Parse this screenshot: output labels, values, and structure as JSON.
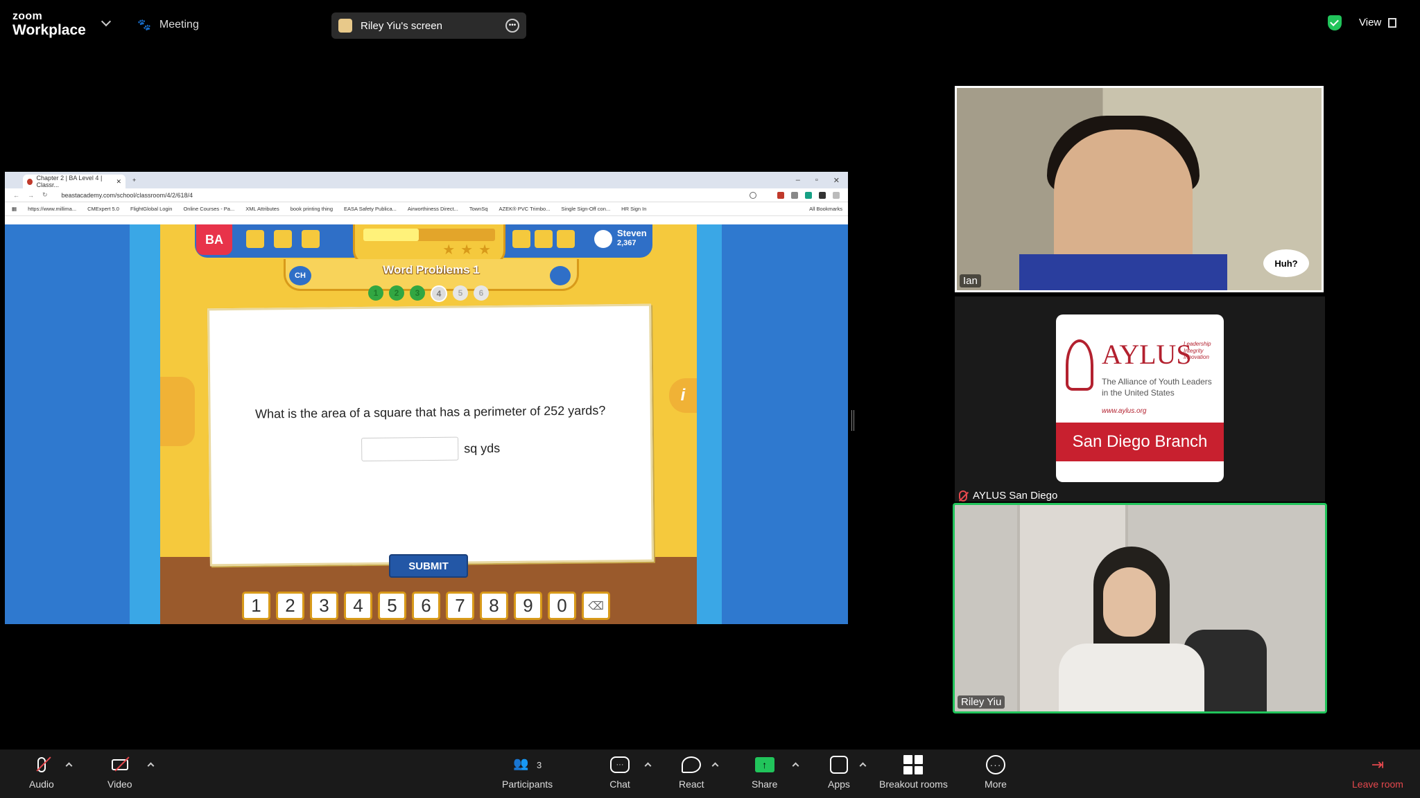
{
  "topbar": {
    "brand_small": "zoom",
    "brand_large": "Workplace",
    "meeting_label": "Meeting",
    "share_label": "Riley Yiu's screen",
    "view_label": "View"
  },
  "browser": {
    "tab_title": "Chapter 2 | BA Level 4 | Classr...",
    "url": "beastacademy.com/school/classroom/4/2/618/4",
    "bookmarks": [
      "https://www.millima...",
      "CMExpert 5.0",
      "FlightGlobal Login",
      "Online Courses - Pa...",
      "XML Attributes",
      "book printing thing",
      "EASA Safety Publica...",
      "Airworthiness Direct...",
      "TownSq",
      "AZEK® PVC Trimbo...",
      "Single Sign-Off con...",
      "HR Sign In"
    ],
    "all_bookmarks": "All Bookmarks"
  },
  "game": {
    "logo": "BA",
    "user_name": "Steven",
    "user_coins": "2,367",
    "chapter_badge": "CH",
    "lesson_title": "Word Problems 1",
    "progress_fraction": 0.42,
    "stars": "★★★",
    "problem_dots": [
      "1",
      "2",
      "3",
      "4",
      "5",
      "6"
    ],
    "current_problem": 4,
    "question": "What is the area of a square that has a perimeter of 252 yards?",
    "answer_value": "",
    "answer_unit": "sq yds",
    "submit_label": "SUBMIT",
    "keypad": [
      "1",
      "2",
      "3",
      "4",
      "5",
      "6",
      "7",
      "8",
      "9",
      "0"
    ],
    "info_label": "i"
  },
  "participants": {
    "ian": {
      "name": "Ian",
      "reaction": "Huh?"
    },
    "aylus": {
      "name": "AYLUS San Diego",
      "logo_word": "AYLUS",
      "tagline": [
        "Leadership",
        "Integrity",
        "Innovation"
      ],
      "subtitle": [
        "The Alliance of Youth Leaders",
        "in the United States"
      ],
      "url": "www.aylus.org",
      "branch": "San Diego Branch"
    },
    "riley": {
      "name": "Riley Yiu"
    }
  },
  "toolbar": {
    "audio": "Audio",
    "video": "Video",
    "participants": "Participants",
    "participants_count": "3",
    "chat": "Chat",
    "react": "React",
    "share": "Share",
    "apps": "Apps",
    "breakout": "Breakout rooms",
    "more": "More",
    "leave": "Leave room"
  }
}
